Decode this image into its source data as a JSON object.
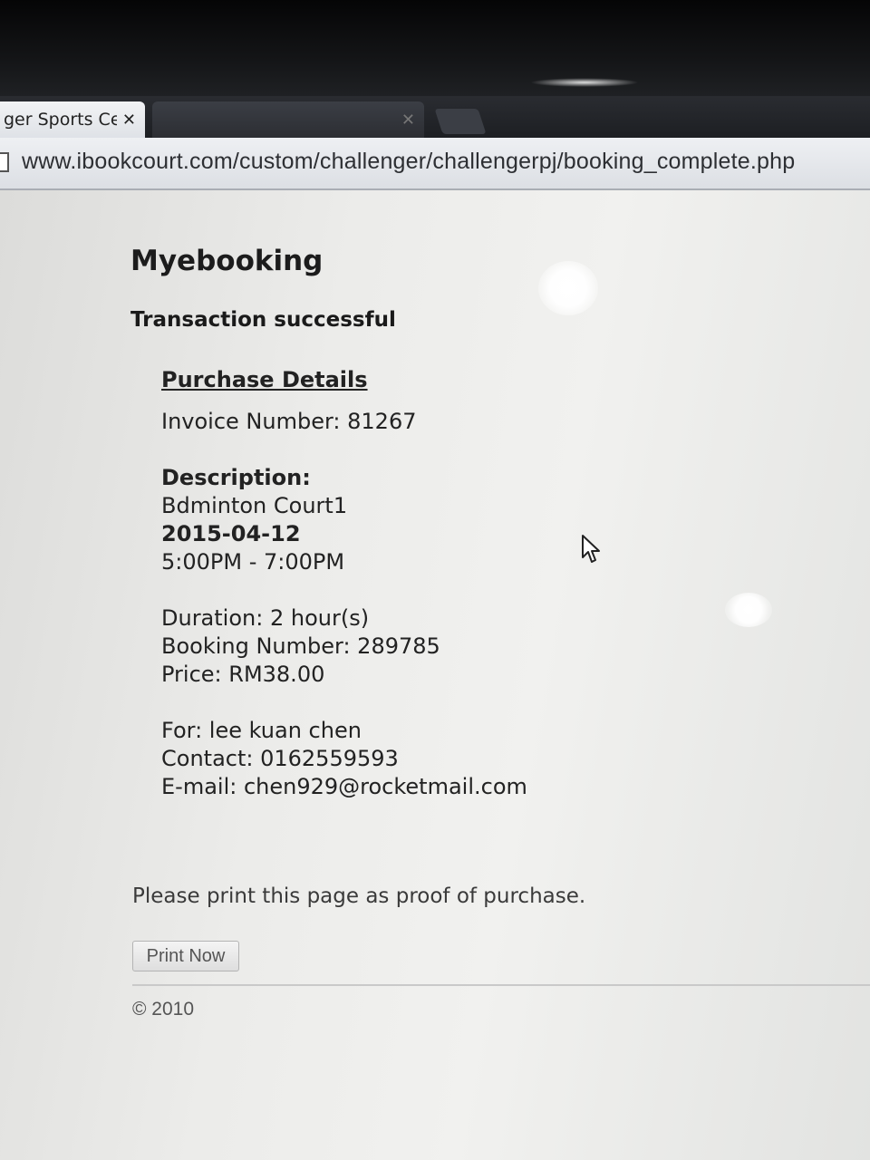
{
  "browser": {
    "tabs": [
      {
        "title": "ger Sports Cer",
        "close": "✕",
        "active": true
      },
      {
        "title": "",
        "close": "✕",
        "active": false
      }
    ],
    "url": "www.ibookcourt.com/custom/challenger/challengerpj/booking_complete.php"
  },
  "page": {
    "site_title": "Myebooking",
    "status": "Transaction successful",
    "purchase": {
      "heading": "Purchase Details",
      "invoice": "Invoice Number: 81267",
      "description_label": "Description:",
      "court": "Bdminton Court1",
      "date": "2015-04-12",
      "time": "5:00PM - 7:00PM",
      "duration": "Duration: 2 hour(s)",
      "booking_number": "Booking Number: 289785",
      "price": "Price: RM38.00",
      "for": "For: lee kuan chen",
      "contact": "Contact: 0162559593",
      "email": "E-mail: chen929@rocketmail.com"
    },
    "proof_note": "Please print this page as proof of purchase.",
    "print_button": "Print Now",
    "footer": "© 2010"
  },
  "icons": {
    "page": "page-icon",
    "cursor": "mouse-cursor-icon"
  }
}
